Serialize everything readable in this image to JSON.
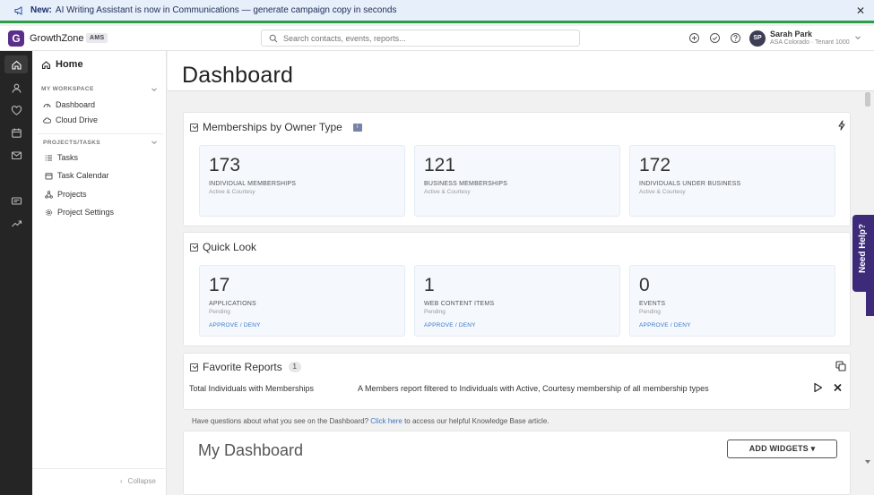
{
  "announcement": {
    "prefix": "New:",
    "text": "AI Writing Assistant is now in Communications — generate campaign copy in seconds",
    "close_icon": "close-icon"
  },
  "header": {
    "brand": "GrowthZone",
    "badge": "AMS",
    "logo_letter": "G",
    "search_placeholder": "Search contacts, events, reports...",
    "icons": [
      "plus-circle-icon",
      "check-circle-icon",
      "help-circle-icon"
    ],
    "user": {
      "initials": "SP",
      "name": "Sarah Park",
      "subtitle": "ASA Colorado · Tenant 1000"
    }
  },
  "rail": {
    "icons": [
      "home-icon",
      "person-icon",
      "heart-icon",
      "calendar-icon",
      "mail-icon",
      "card-icon",
      "trend-icon"
    ]
  },
  "nav": {
    "home_label": "Home",
    "workspace": {
      "title": "MY WORKSPACE",
      "items": [
        {
          "label": "Dashboard",
          "icon": "gauge-icon"
        },
        {
          "label": "Cloud Drive",
          "icon": "cloud-icon"
        }
      ]
    },
    "projects": {
      "title": "PROJECTS/TASKS",
      "items": [
        {
          "label": "Tasks",
          "icon": "list-icon"
        },
        {
          "label": "Task Calendar",
          "icon": "calendar-icon"
        },
        {
          "label": "Projects",
          "icon": "nodes-icon"
        },
        {
          "label": "Project Settings",
          "icon": "gear-icon"
        }
      ]
    },
    "collapse_label": "Collapse"
  },
  "page": {
    "title": "Dashboard"
  },
  "memberships": {
    "title": "Memberships by Owner Type",
    "info_badge": "i",
    "stats": [
      {
        "value": "173",
        "label": "INDIVIDUAL MEMBERSHIPS",
        "sub": "Active & Courtesy"
      },
      {
        "value": "121",
        "label": "BUSINESS MEMBERSHIPS",
        "sub": "Active & Courtesy"
      },
      {
        "value": "172",
        "label": "INDIVIDUALS UNDER BUSINESS",
        "sub": "Active & Courtesy"
      }
    ]
  },
  "quick_look": {
    "title": "Quick Look",
    "stats": [
      {
        "value": "17",
        "label": "APPLICATIONS",
        "sub": "Pending",
        "action": "APPROVE / DENY"
      },
      {
        "value": "1",
        "label": "WEB CONTENT ITEMS",
        "sub": "Pending",
        "action": "APPROVE / DENY"
      },
      {
        "value": "0",
        "label": "EVENTS",
        "sub": "Pending",
        "action": "APPROVE / DENY"
      }
    ]
  },
  "favorites": {
    "title": "Favorite Reports",
    "count": "1",
    "reports": [
      {
        "name": "Total Individuals with Memberships",
        "description": "A Members report filtered to Individuals with Active, Courtesy membership of all membership types"
      }
    ]
  },
  "kb_note": {
    "before": "Have questions about what you see on the Dashboard?",
    "link": "Click here",
    "after": "to access our helpful Knowledge Base article."
  },
  "my_dashboard": {
    "title": "My Dashboard",
    "add_widgets": "ADD WIDGETS ▾"
  },
  "help_tab": {
    "label": "Need Help?"
  }
}
